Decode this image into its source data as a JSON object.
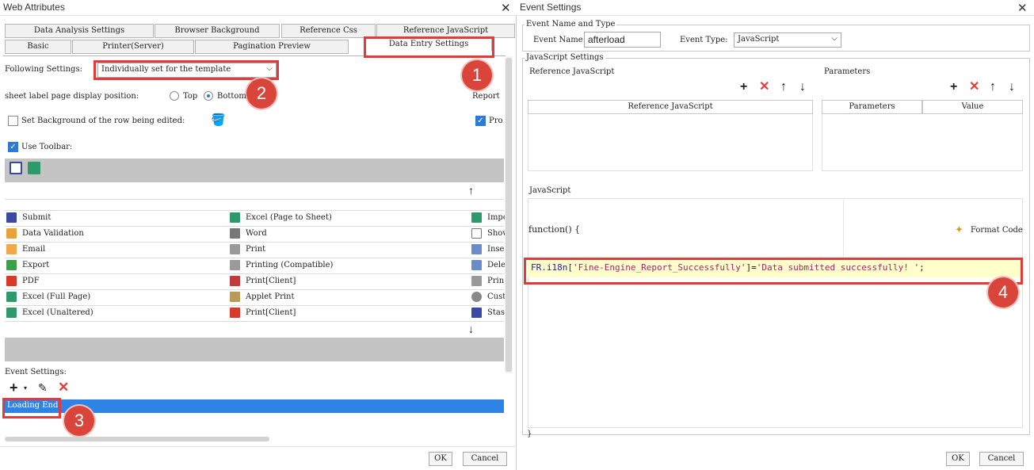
{
  "left_window": {
    "title": "Web Attributes",
    "tabs_row1": [
      "Data Analysis Settings",
      "Browser Background",
      "Reference Css",
      "Reference JavaScript"
    ],
    "tabs_row2": [
      "Basic",
      "Printer(Server)",
      "Pagination Preview",
      "Data Entry Settings"
    ],
    "following_label": "Following Settings:",
    "following_value": "Individually set for the template",
    "sheet_label": "sheet label page display position:",
    "radio_top": "Top",
    "radio_bottom": "Bottom",
    "report_label": "Report",
    "set_bg_label": "Set Background of the row being edited:",
    "pro_label": "Pro",
    "use_toolbar_label": "Use Toolbar:",
    "tool_items": {
      "col1": [
        "Submit",
        "Data Validation",
        "Email",
        "Export",
        "PDF",
        "Excel (Full Page)",
        "Excel (Unaltered)"
      ],
      "col2": [
        "Excel (Page to Sheet)",
        "Word",
        "Print",
        "Printing (Compatible)",
        "Print[Client]",
        "Applet Print",
        "Print[Client]"
      ],
      "col3": [
        "Impo",
        "Show",
        "Inse",
        "Dele",
        "Prin",
        "Cust",
        "Stas"
      ]
    },
    "event_settings_label": "Event Settings:",
    "event_item": "Loading End",
    "ok_label": "OK",
    "cancel_label": "Cancel"
  },
  "right_window": {
    "title": "Event Settings",
    "group1_label": "Event Name and Type",
    "event_name_label": "Event Name:",
    "event_name_value": "afterload",
    "event_type_label": "Event Type:",
    "event_type_value": "JavaScript",
    "group2_label": "JavaScript Settings",
    "ref_js_label": "Reference JavaScript",
    "params_label": "Parameters",
    "ref_js_col": "Reference JavaScript",
    "params_col": "Parameters",
    "value_col": "Value",
    "js_label": "JavaScript",
    "function_open": "function() {",
    "format_code_label": "Format Code",
    "code_prefix": "FR.i18n[",
    "code_key": "'Fine-Engine_Report_Successfully'",
    "code_mid": "]=",
    "code_value": "'Data submitted successfully! '",
    "code_end": ";",
    "function_close": "}",
    "ok_label": "OK",
    "cancel_label": "Cancel"
  },
  "annotations": [
    "1",
    "2",
    "3",
    "4"
  ],
  "colors": {
    "accent": "#2d7ad6",
    "highlight_red": "#e23b3b",
    "badge": "#d9453a",
    "code_bg": "#ffffcc",
    "toolbar_gray": "#c4c4c4"
  }
}
